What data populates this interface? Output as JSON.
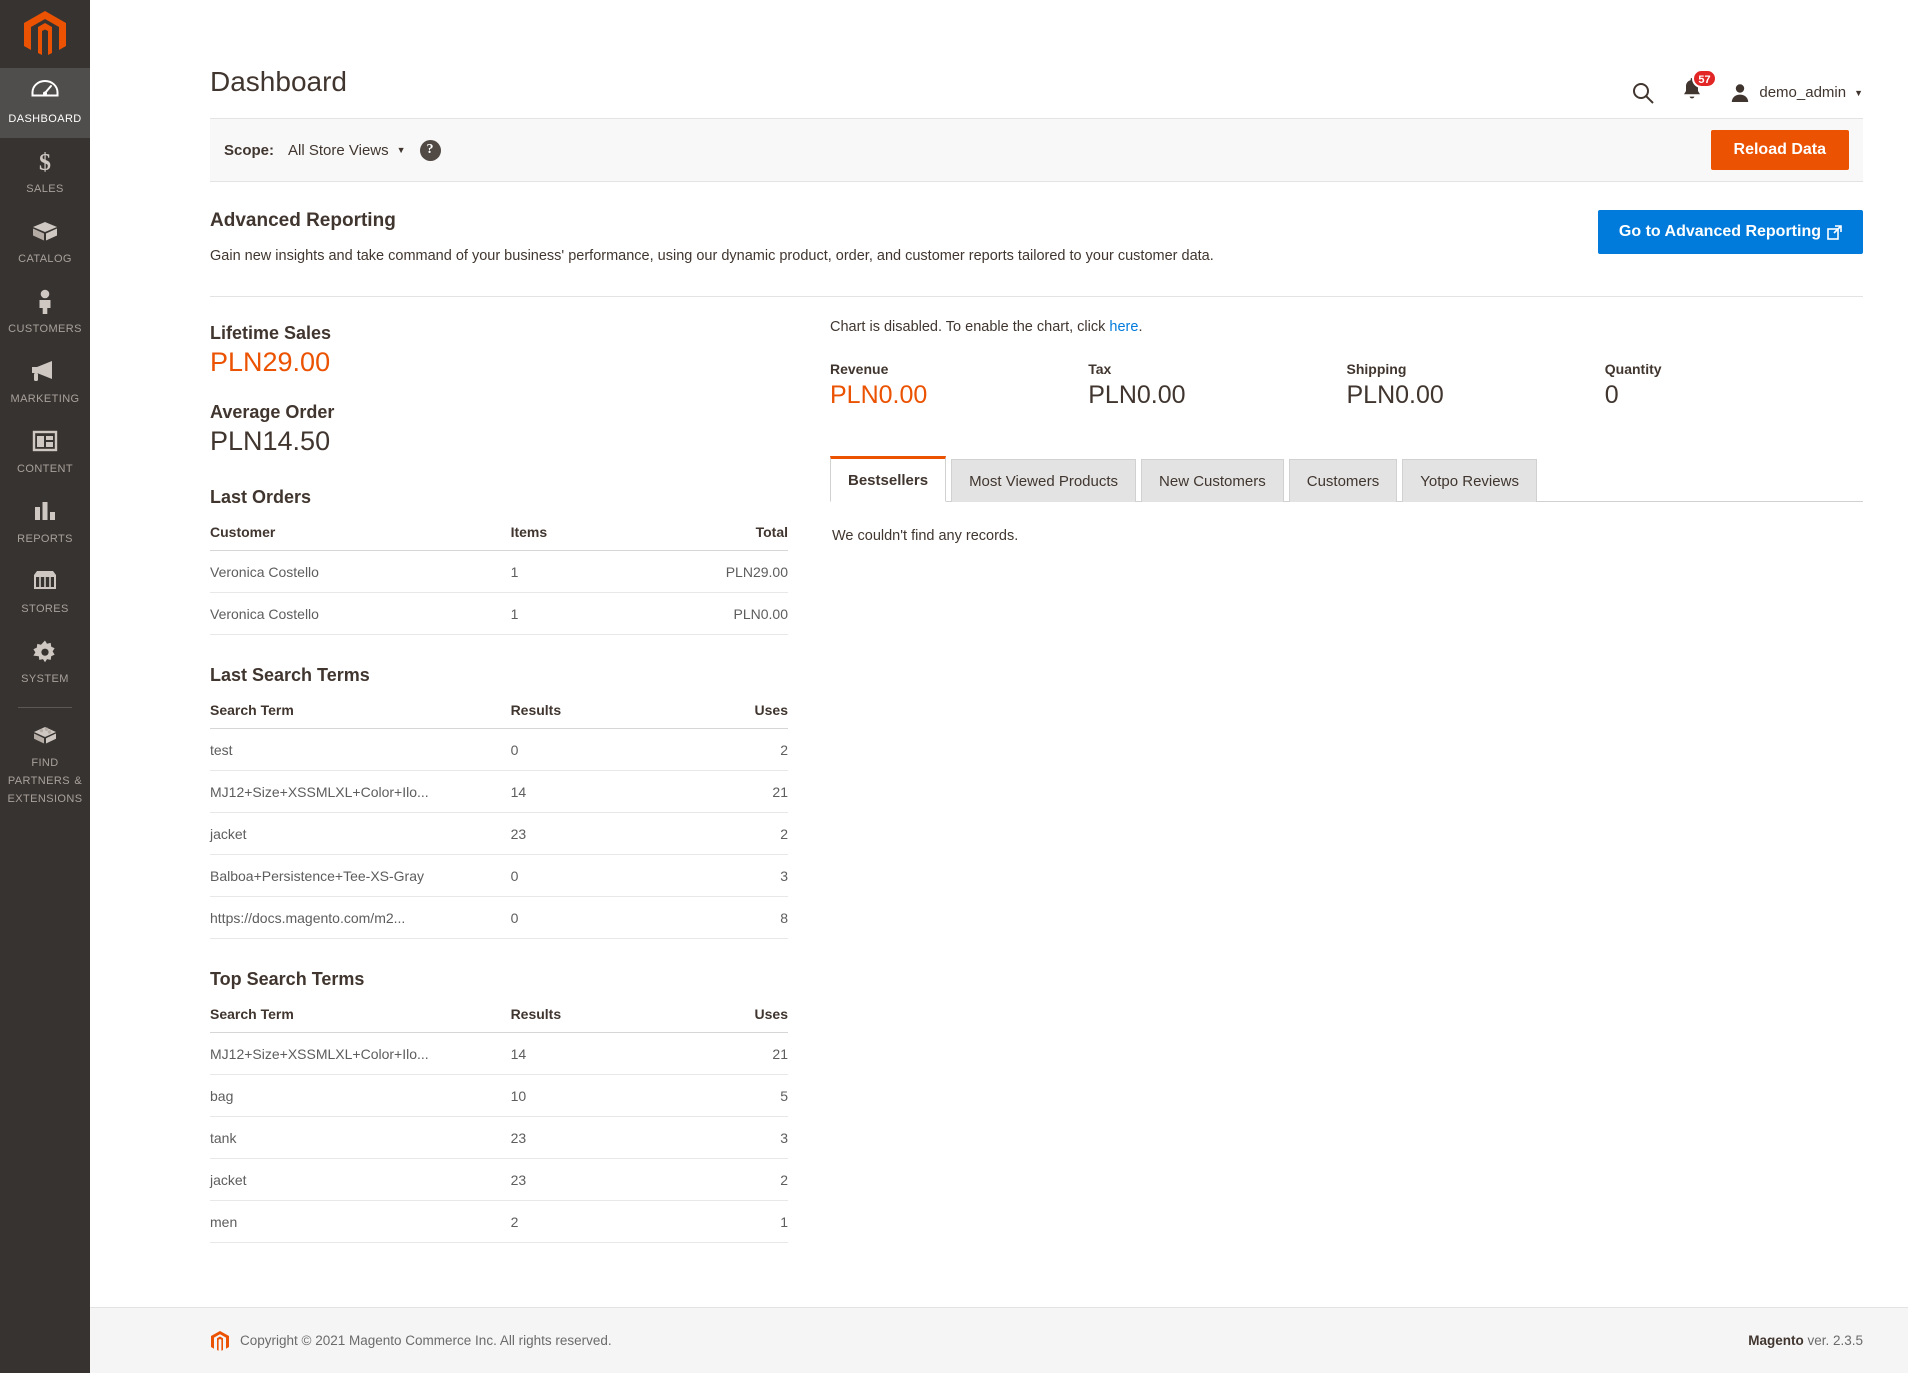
{
  "sidebar": {
    "logo_name": "magento-logo",
    "items": [
      {
        "label": "DASHBOARD",
        "icon": "gauge-icon",
        "active": true
      },
      {
        "label": "SALES",
        "icon": "dollar-icon",
        "active": false
      },
      {
        "label": "CATALOG",
        "icon": "box-icon",
        "active": false
      },
      {
        "label": "CUSTOMERS",
        "icon": "person-icon",
        "active": false
      },
      {
        "label": "MARKETING",
        "icon": "megaphone-icon",
        "active": false
      },
      {
        "label": "CONTENT",
        "icon": "layout-icon",
        "active": false
      },
      {
        "label": "REPORTS",
        "icon": "bar-chart-icon",
        "active": false
      },
      {
        "label": "STORES",
        "icon": "storefront-icon",
        "active": false
      },
      {
        "label": "SYSTEM",
        "icon": "gear-icon",
        "active": false
      }
    ],
    "footer_item": {
      "label_line1": "FIND PARTNERS",
      "label_line2": "& EXTENSIONS",
      "icon": "brick-icon"
    }
  },
  "header": {
    "title": "Dashboard",
    "search_icon": "search-icon",
    "notifications_icon": "bell-icon",
    "notifications_count": "57",
    "user_icon": "user-avatar-icon",
    "user_name": "demo_admin",
    "caret": "▼"
  },
  "scope": {
    "label": "Scope:",
    "selected": "All Store Views",
    "caret": "▼",
    "help_glyph": "?",
    "reload_label": "Reload Data"
  },
  "advanced_reporting": {
    "title": "Advanced Reporting",
    "description": "Gain new insights and take command of your business' performance, using our dynamic product, order, and customer reports tailored to your customer data.",
    "button_label": "Go to Advanced Reporting",
    "button_icon": "external-link-icon"
  },
  "lifetime_sales": {
    "label": "Lifetime Sales",
    "value": "PLN29.00"
  },
  "average_order": {
    "label": "Average Order",
    "value": "PLN14.50"
  },
  "last_orders": {
    "title": "Last Orders",
    "columns": [
      "Customer",
      "Items",
      "Total"
    ],
    "rows": [
      {
        "customer": "Veronica Costello",
        "items": "1",
        "total": "PLN29.00"
      },
      {
        "customer": "Veronica Costello",
        "items": "1",
        "total": "PLN0.00"
      }
    ]
  },
  "last_search_terms": {
    "title": "Last Search Terms",
    "columns": [
      "Search Term",
      "Results",
      "Uses"
    ],
    "rows": [
      {
        "term": "test",
        "results": "0",
        "uses": "2"
      },
      {
        "term": "MJ12+Size+XSSMLXL+Color+Ilo...",
        "results": "14",
        "uses": "21"
      },
      {
        "term": "jacket",
        "results": "23",
        "uses": "2"
      },
      {
        "term": "Balboa+Persistence+Tee-XS-Gray",
        "results": "0",
        "uses": "3"
      },
      {
        "term": "https://docs.magento.com/m2...",
        "results": "0",
        "uses": "8"
      }
    ]
  },
  "top_search_terms": {
    "title": "Top Search Terms",
    "columns": [
      "Search Term",
      "Results",
      "Uses"
    ],
    "rows": [
      {
        "term": "MJ12+Size+XSSMLXL+Color+Ilo...",
        "results": "14",
        "uses": "21"
      },
      {
        "term": "bag",
        "results": "10",
        "uses": "5"
      },
      {
        "term": "tank",
        "results": "23",
        "uses": "3"
      },
      {
        "term": "jacket",
        "results": "23",
        "uses": "2"
      },
      {
        "term": "men",
        "results": "2",
        "uses": "1"
      }
    ]
  },
  "chart": {
    "note_prefix": "Chart is disabled. To enable the chart, click ",
    "note_link": "here",
    "note_suffix": ".",
    "totals": [
      {
        "label": "Revenue",
        "value": "PLN0.00",
        "accent": true
      },
      {
        "label": "Tax",
        "value": "PLN0.00",
        "accent": false
      },
      {
        "label": "Shipping",
        "value": "PLN0.00",
        "accent": false
      },
      {
        "label": "Quantity",
        "value": "0",
        "accent": false
      }
    ]
  },
  "tabs": {
    "items": [
      {
        "label": "Bestsellers",
        "active": true
      },
      {
        "label": "Most Viewed Products",
        "active": false
      },
      {
        "label": "New Customers",
        "active": false
      },
      {
        "label": "Customers",
        "active": false
      },
      {
        "label": "Yotpo Reviews",
        "active": false
      }
    ],
    "empty_message": "We couldn't find any records."
  },
  "footer": {
    "logo_icon": "magento-footer-icon",
    "copyright": "Copyright © 2021 Magento Commerce Inc. All rights reserved.",
    "brand": "Magento",
    "version": " ver. 2.3.5"
  },
  "colors": {
    "accent_orange": "#eb5202",
    "link_blue": "#007bdb",
    "sidebar_bg": "#373330",
    "badge_red": "#e22626"
  }
}
